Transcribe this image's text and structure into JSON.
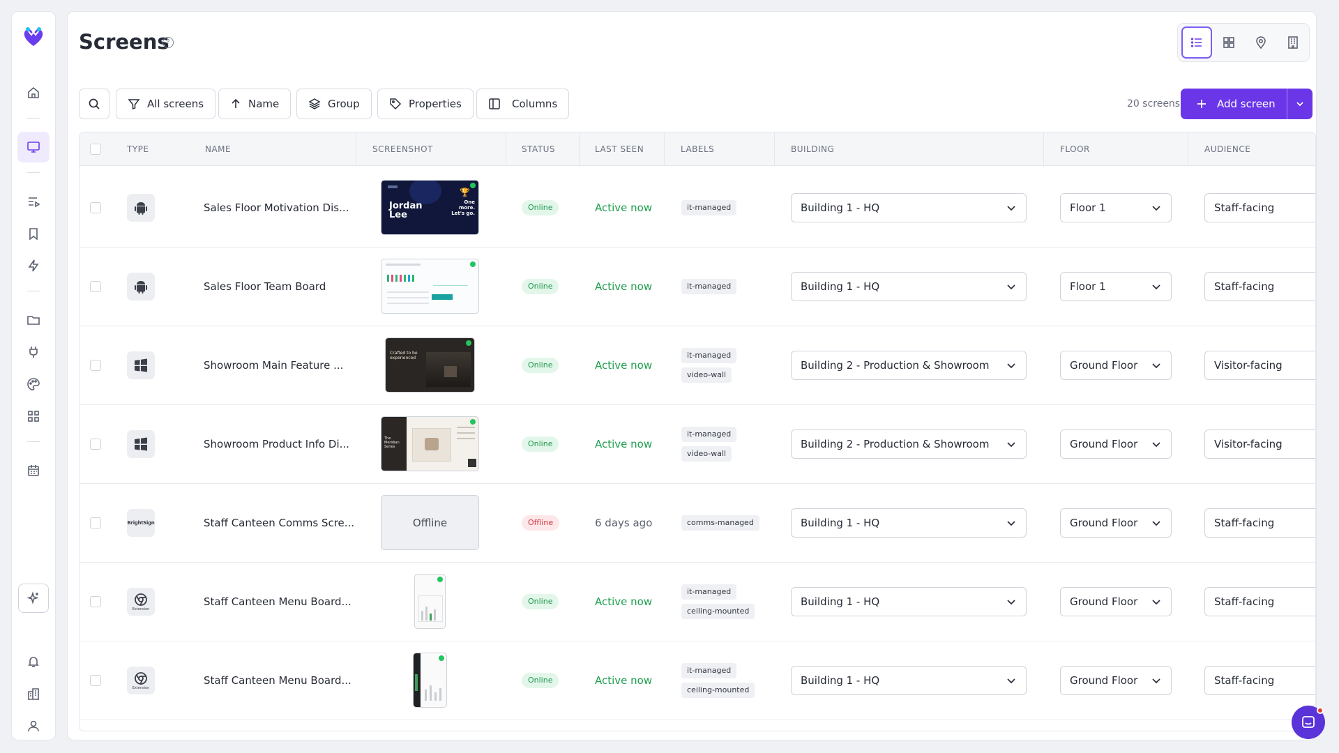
{
  "sidebar": {
    "logo": "heart-logo-icon",
    "items": [
      "home-icon",
      "monitor-icon",
      "playlist-icon",
      "bookmark-icon",
      "lightning-icon",
      "folder-icon",
      "plug-icon",
      "palette-icon",
      "apps-grid-icon",
      "calendar-icon"
    ],
    "bottom": [
      "sparkle-icon",
      "bell-icon",
      "building-icon",
      "user-icon"
    ]
  },
  "page": {
    "title": "Screens",
    "help": "?"
  },
  "view_switch": [
    "list-view-icon",
    "grid-view-icon",
    "map-pin-icon",
    "building-view-icon"
  ],
  "toolbar": {
    "filter": "All screens",
    "sort": "Name",
    "group": "Group",
    "properties": "Properties",
    "columns": "Columns",
    "count": "20 screens",
    "add": "Add screen"
  },
  "table": {
    "headers": [
      "TYPE",
      "NAME",
      "SCREENSHOT",
      "STATUS",
      "LAST SEEN",
      "LABELS",
      "BUILDING",
      "FLOOR",
      "AUDIENCE"
    ],
    "rows": [
      {
        "type": "android",
        "name": "Sales Floor Motivation Dis...",
        "shot": "dark",
        "shot_title": "Jordan Lee",
        "shot_side": "One more. Let's go.",
        "status": "Online",
        "seen": "Active now",
        "labels": [
          "it-managed"
        ],
        "building": "Building 1 - HQ",
        "floor": "Floor 1",
        "audience": "Staff-facing"
      },
      {
        "type": "android",
        "name": "Sales Floor Team Board",
        "shot": "dashboard",
        "status": "Online",
        "seen": "Active now",
        "labels": [
          "it-managed"
        ],
        "building": "Building 1 - HQ",
        "floor": "Floor 1",
        "audience": "Staff-facing"
      },
      {
        "type": "windows",
        "name": "Showroom Main Feature ...",
        "shot": "showroom",
        "shot_title": "Crafted to be experienced",
        "status": "Online",
        "seen": "Active now",
        "labels": [
          "it-managed",
          "video-wall"
        ],
        "building": "Building 2 - Production & Showroom",
        "floor": "Ground Floor",
        "audience": "Visitor-facing"
      },
      {
        "type": "windows",
        "name": "Showroom Product Info Di...",
        "shot": "product",
        "shot_title": "The Meridian Series",
        "status": "Online",
        "seen": "Active now",
        "labels": [
          "it-managed",
          "video-wall"
        ],
        "building": "Building 2 - Production & Showroom",
        "floor": "Ground Floor",
        "audience": "Visitor-facing"
      },
      {
        "type": "brightsign",
        "type_text": "BrightSign",
        "name": "Staff Canteen Comms Scre...",
        "shot": "offline",
        "shot_title": "Offline",
        "status": "Offline",
        "seen": "6 days ago",
        "labels": [
          "comms-managed"
        ],
        "building": "Building 1 - HQ",
        "floor": "Ground Floor",
        "audience": "Staff-facing"
      },
      {
        "type": "chrome",
        "type_text": "Extension",
        "name": "Staff Canteen Menu Board...",
        "shot": "portrait-light",
        "status": "Online",
        "seen": "Active now",
        "labels": [
          "it-managed",
          "ceiling-mounted"
        ],
        "building": "Building 1 - HQ",
        "floor": "Ground Floor",
        "audience": "Staff-facing"
      },
      {
        "type": "chrome",
        "type_text": "Extension",
        "name": "Staff Canteen Menu Board...",
        "shot": "portrait-dark",
        "status": "Online",
        "seen": "Active now",
        "labels": [
          "it-managed",
          "ceiling-mounted"
        ],
        "building": "Building 1 - HQ",
        "floor": "Ground Floor",
        "audience": "Staff-facing"
      }
    ]
  }
}
